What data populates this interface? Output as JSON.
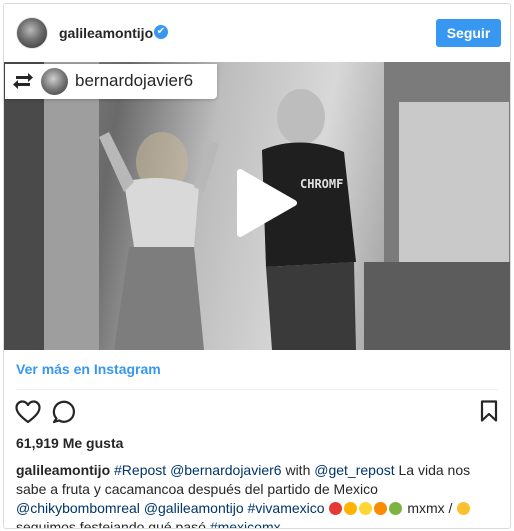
{
  "header": {
    "username": "galileamontijo",
    "verified_mark": "✔",
    "follow_label": "Seguir"
  },
  "video": {
    "repost_user": "bernardojavier6",
    "shirt_text": "CHROMF"
  },
  "more_link": "Ver más en Instagram",
  "likes": "61,919 Me gusta",
  "caption": {
    "user": "galileamontijo",
    "tag1": "#Repost",
    "mention1": "@bernardojavier6",
    "with_text": " with ",
    "mention2": "@get_repost",
    "text1": " La vida nos sabe a fruta y cacamancoa después del partido de Mexico ",
    "mention3": "@chikybombomreal",
    "mention4": "@galileamontijo",
    "tag2": "#vivamexico",
    "text2": " mxmx / ",
    "text3": " seguimos festejando qué pasó ",
    "tag3": "#mexicomx"
  },
  "colors": {
    "accent": "#3897f0",
    "link": "#003569",
    "text": "#262626"
  },
  "icons": [
    "repost-icon",
    "verified-icon",
    "play-icon",
    "heart-icon",
    "comment-icon",
    "bookmark-icon"
  ]
}
